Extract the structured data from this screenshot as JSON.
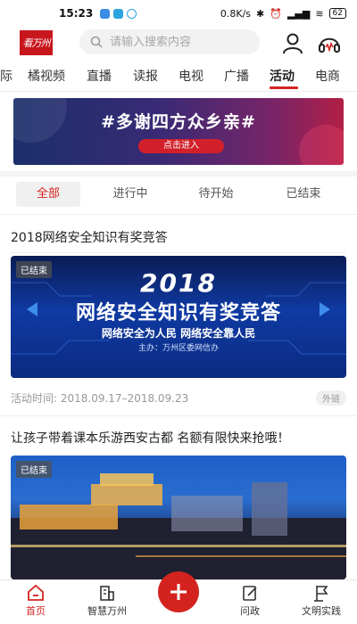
{
  "status_bar": {
    "time": "15:23",
    "network_speed": "0.8K/s",
    "battery": "62"
  },
  "header": {
    "logo_text": "看万州",
    "search_placeholder": "请输入搜索内容"
  },
  "channel_tabs": [
    {
      "label": "际"
    },
    {
      "label": "橘视频"
    },
    {
      "label": "直播"
    },
    {
      "label": "读报"
    },
    {
      "label": "电视"
    },
    {
      "label": "广播"
    },
    {
      "label": "活动"
    },
    {
      "label": "电商"
    }
  ],
  "active_channel": "活动",
  "banner": {
    "title": "#多谢四方众乡亲#",
    "button": "点击进入"
  },
  "filter_tabs": [
    {
      "label": "全部"
    },
    {
      "label": "进行中"
    },
    {
      "label": "待开始"
    },
    {
      "label": "已结束"
    }
  ],
  "activities": [
    {
      "title": "2018网络安全知识有奖竞答",
      "badge": "已结束",
      "image_year": "2018",
      "image_headline": "网络安全知识有奖竞答",
      "image_subline": "网络安全为人民   网络安全靠人民",
      "image_host": "主办：万州区委网信办",
      "time_label": "活动时间: 2018.09.17–2018.09.23",
      "tag": "外链"
    },
    {
      "title": "让孩子带着课本乐游西安古都 名额有限快来抢哦！",
      "badge": "已结束"
    }
  ],
  "bottom_nav": [
    {
      "label": "首页",
      "icon": "home-icon"
    },
    {
      "label": "智慧万州",
      "icon": "building-icon"
    },
    {
      "label": "",
      "icon": "plus-icon"
    },
    {
      "label": "问政",
      "icon": "edit-icon"
    },
    {
      "label": "文明实践",
      "icon": "flag-icon"
    }
  ],
  "colors": {
    "accent": "#d4231f",
    "logo_bg": "#c8161d"
  }
}
